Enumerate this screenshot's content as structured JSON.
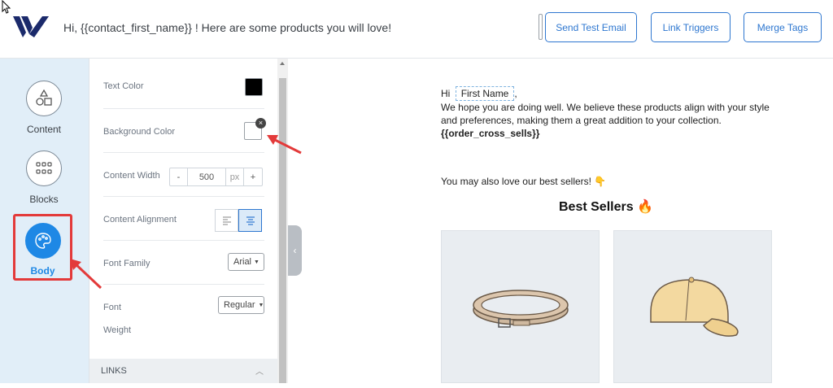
{
  "header": {
    "subject": "Hi, {{contact_first_name}} ! Here are some products you will love!",
    "buttons": [
      "Send Test Email",
      "Link Triggers",
      "Merge Tags"
    ]
  },
  "sidebar": {
    "items": [
      {
        "label": "Content",
        "icon": "shapes-icon"
      },
      {
        "label": "Blocks",
        "icon": "grid-icon"
      },
      {
        "label": "Body",
        "icon": "palette-icon",
        "active": true
      }
    ]
  },
  "settings": {
    "text_color_label": "Text Color",
    "text_color": "#000000",
    "background_color_label": "Background Color",
    "content_width_label": "Content Width",
    "width_minus": "-",
    "width_value": "500",
    "width_unit": "px",
    "width_plus": "+",
    "content_alignment_label": "Content Alignment",
    "font_family_label": "Font Family",
    "font_family_value": "Arial",
    "font_weight_label_1": "Font",
    "font_weight_label_2": "Weight",
    "font_weight_value": "Regular",
    "links_label": "LINKS"
  },
  "preview": {
    "greeting": "Hi",
    "first_name": "First Name",
    "comma": ",",
    "line1": "We hope you are doing well. We believe these products align with your style",
    "line2": "and preferences, making them a great addition to your collection.",
    "merge_tag": "{{order_cross_sells}}",
    "best_sellers_intro": "You may also love our best sellers! 👇",
    "best_sellers_title": "Best Sellers 🔥"
  },
  "colors": {
    "accent": "#2e77d0",
    "annotation": "#e33a3a",
    "sidebar_bg": "#e1eef8"
  }
}
